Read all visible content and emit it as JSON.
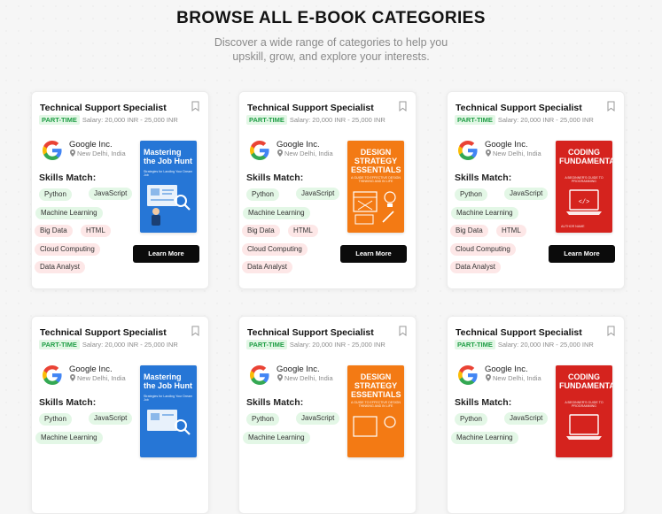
{
  "header": {
    "heading": "BROWSE ALL E-BOOK CATEGORIES",
    "subtitle_line1": "Discover a wide range of categories to help you",
    "subtitle_line2": "upskill, grow, and explore your interests."
  },
  "colors": {
    "badge_green": "#1f9e45",
    "chip_green": "#e3f7e6",
    "chip_red": "#fde7e7",
    "button": "#0b0b0b"
  },
  "cards": [
    {
      "title": "Technical Support Specialist",
      "badge": "PART-TIME",
      "salary": "Salary: 20,000 INR - 25,000 INR",
      "company": "Google Inc.",
      "location": "New Delhi, India",
      "skills_label": "Skills Match:",
      "skills": [
        "Python",
        "JavaScript",
        "Machine Learning",
        "Big Data",
        "HTML",
        "Cloud Computing",
        "Data Analyst"
      ],
      "book": {
        "title": "Mastering the Job Hunt",
        "subtitle": "Strategies for Landing Your Dream Job",
        "author": ""
      },
      "button": "Learn More",
      "icons": [
        "bookmark-icon",
        "google-logo",
        "location-pin-icon"
      ]
    },
    {
      "title": "Technical Support Specialist",
      "badge": "PART-TIME",
      "salary": "Salary: 20,000 INR - 25,000 INR",
      "company": "Google Inc.",
      "location": "New Delhi, India",
      "skills_label": "Skills Match:",
      "skills": [
        "Python",
        "JavaScript",
        "Machine Learning",
        "Big Data",
        "HTML",
        "Cloud Computing",
        "Data Analyst"
      ],
      "book": {
        "title": "DESIGN STRATEGY ESSENTIALS",
        "subtitle": "A GUIDE TO EFFECTIVE DESIGN THINKING AND IN LIFE",
        "author": ""
      },
      "button": "Learn More",
      "icons": [
        "bookmark-icon",
        "google-logo",
        "location-pin-icon"
      ]
    },
    {
      "title": "Technical Support Specialist",
      "badge": "PART-TIME",
      "salary": "Salary: 20,000 INR - 25,000 INR",
      "company": "Google Inc.",
      "location": "New Delhi, India",
      "skills_label": "Skills Match:",
      "skills": [
        "Python",
        "JavaScript",
        "Machine Learning",
        "Big Data",
        "HTML",
        "Cloud Computing",
        "Data Analyst"
      ],
      "book": {
        "title": "CODING FUNDAMENTALS",
        "subtitle": "A BEGINNER'S GUIDE TO PROGRAMMING",
        "author": "AUTHOR NAME"
      },
      "button": "Learn More",
      "icons": [
        "bookmark-icon",
        "google-logo",
        "location-pin-icon"
      ]
    },
    {
      "title": "Technical Support Specialist",
      "badge": "PART-TIME",
      "salary": "Salary: 20,000 INR - 25,000 INR",
      "company": "Google Inc.",
      "location": "New Delhi, India",
      "skills_label": "Skills Match:",
      "skills": [
        "Python",
        "JavaScript",
        "Machine Learning"
      ],
      "book": {
        "title": "Mastering the Job Hunt",
        "subtitle": "Strategies for Landing Your Dream Job",
        "author": ""
      },
      "button": "",
      "icons": [
        "bookmark-icon",
        "google-logo",
        "location-pin-icon"
      ]
    },
    {
      "title": "Technical Support Specialist",
      "badge": "PART-TIME",
      "salary": "Salary: 20,000 INR - 25,000 INR",
      "company": "Google Inc.",
      "location": "New Delhi, India",
      "skills_label": "Skills Match:",
      "skills": [
        "Python",
        "JavaScript",
        "Machine Learning"
      ],
      "book": {
        "title": "DESIGN STRATEGY ESSENTIALS",
        "subtitle": "A GUIDE TO EFFECTIVE DESIGN THINKING AND IN LIFE",
        "author": ""
      },
      "button": "",
      "icons": [
        "bookmark-icon",
        "google-logo",
        "location-pin-icon"
      ]
    },
    {
      "title": "Technical Support Specialist",
      "badge": "PART-TIME",
      "salary": "Salary: 20,000 INR - 25,000 INR",
      "company": "Google Inc.",
      "location": "New Delhi, India",
      "skills_label": "Skills Match:",
      "skills": [
        "Python",
        "JavaScript",
        "Machine Learning"
      ],
      "book": {
        "title": "CODING FUNDAMENTALS",
        "subtitle": "A BEGINNER'S GUIDE TO PROGRAMMING",
        "author": ""
      },
      "button": "",
      "icons": [
        "bookmark-icon",
        "google-logo",
        "location-pin-icon"
      ]
    }
  ]
}
